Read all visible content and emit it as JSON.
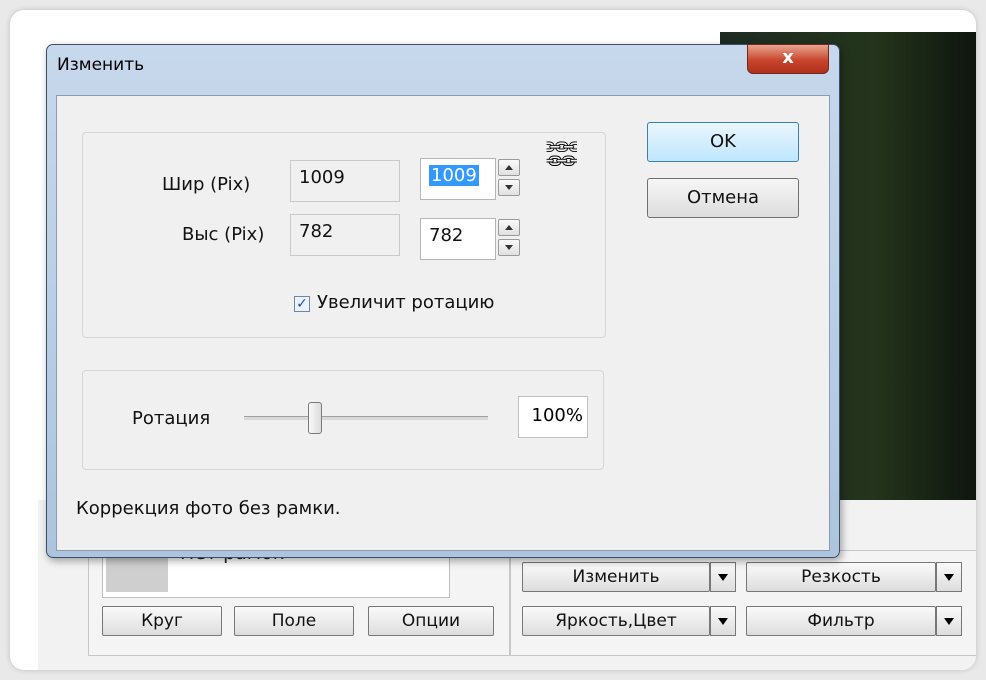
{
  "dialog": {
    "title": "Изменить",
    "close_label": "x",
    "width_label": "Шир (Pix)",
    "width_original": "1009",
    "width_value": "1009",
    "height_label": "Выс (Pix)",
    "height_original": "782",
    "height_value": "782",
    "rotate_checkbox_label": "Увеличит ротацию",
    "rotate_checked": true,
    "rotation_label": "Ротация",
    "rotation_value": "100%",
    "rotation_fraction": 0.29,
    "ok_label": "OK",
    "cancel_label": "Отмена",
    "status_text": "Коррекция фото без рамки."
  },
  "background": {
    "frame_select": "Нет рамок",
    "circle_button": "Круг",
    "field_button": "Поле",
    "options_button": "Опции",
    "edit_button": "Изменить",
    "sharpness_button": "Резкость",
    "brightness_button": "Яркость,Цвет",
    "filter_button": "Фильтр"
  },
  "colors": {
    "title_bar": "#c7d8ec",
    "close": "#c8452c",
    "selection": "#3399ff",
    "default_button": "#bee6fd"
  },
  "icons": {
    "chain": "link-icon",
    "close": "close-icon"
  }
}
